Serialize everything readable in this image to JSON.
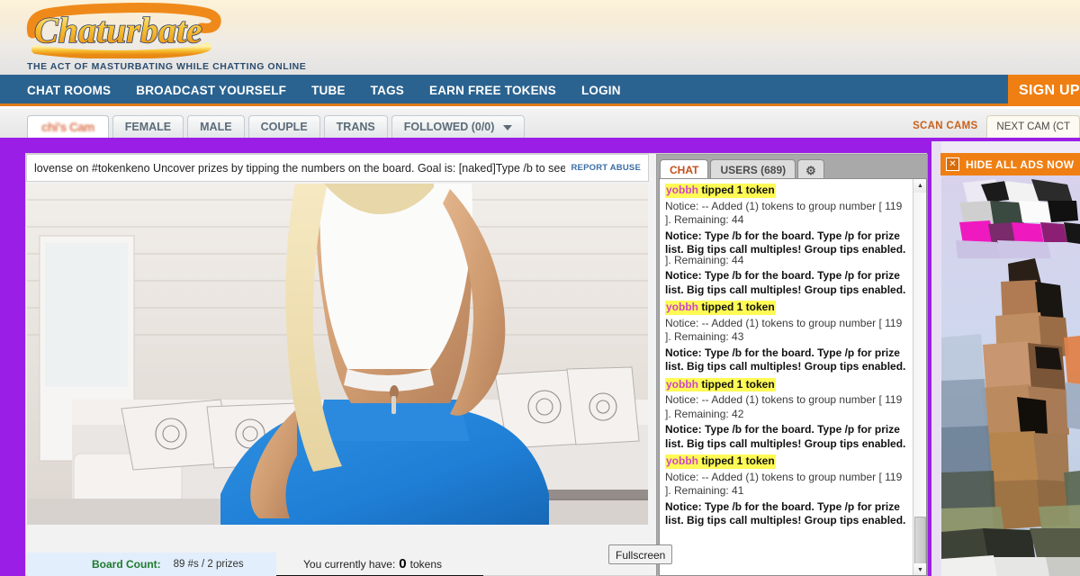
{
  "site": {
    "logo_text": "Chaturbate",
    "tagline": "THE ACT OF MASTURBATING WHILE CHATTING ONLINE"
  },
  "nav": {
    "items": [
      {
        "label": "CHAT ROOMS"
      },
      {
        "label": "BROADCAST YOURSELF"
      },
      {
        "label": "TUBE"
      },
      {
        "label": "TAGS"
      },
      {
        "label": "EARN FREE TOKENS"
      },
      {
        "label": "LOGIN"
      }
    ],
    "signup_label": "SIGN UP"
  },
  "subnav": {
    "tabs": [
      {
        "label": "chi's Cam",
        "active": true,
        "obscured": true
      },
      {
        "label": "FEMALE",
        "active": false
      },
      {
        "label": "MALE",
        "active": false
      },
      {
        "label": "COUPLE",
        "active": false
      },
      {
        "label": "TRANS",
        "active": false
      },
      {
        "label": "FOLLOWED (0/0)",
        "active": false,
        "caret": true
      }
    ],
    "scan_cams_label": "SCAN CAMS",
    "next_cam_label": "NEXT CAM (CT"
  },
  "player": {
    "topic": "lovense on #tokenkeno Uncover prizes by tipping the numbers on the board. Goal is: [naked]Type /b to see",
    "report_abuse_label": "REPORT ABUSE",
    "fullscreen_tooltip": "Fullscreen",
    "resize_handle_glyph": "◄►"
  },
  "info_strip": {
    "board_count_label": "Board Count:",
    "board_count_value": "89 #s / 2 prizes",
    "tokens_prefix": "You currently have:",
    "tokens_value": "0",
    "tokens_suffix": "tokens"
  },
  "chat": {
    "tabs": [
      {
        "label": "CHAT",
        "active": true
      },
      {
        "label": "USERS (689)",
        "active": false
      }
    ],
    "settings_icon_glyph": "⚙",
    "scroll_up_glyph": "▲",
    "scroll_down_glyph": "▼",
    "messages": [
      {
        "kind": "tip",
        "user": "yobbh",
        "text": " tipped 1 token"
      },
      {
        "kind": "notice-plain",
        "text": "Notice: -- Added (1) tokens to group number [ 119 ]. Remaining: 44"
      },
      {
        "kind": "notice-bold",
        "text": "Notice: Type /b for the board. Type /p for prize list. Big tips call multiples! Group tips enabled.",
        "clipped": true
      },
      {
        "kind": "notice-plain",
        "text": "]. Remaining: 44",
        "overlap": true
      },
      {
        "kind": "notice-bold",
        "text": "Notice: Type /b for the board. Type /p for prize list. Big tips call multiples! Group tips enabled."
      },
      {
        "kind": "tip",
        "user": "yobbh",
        "text": " tipped 1 token"
      },
      {
        "kind": "notice-plain",
        "text": "Notice: -- Added (1) tokens to group number [ 119 ]. Remaining: 43"
      },
      {
        "kind": "notice-bold",
        "text": "Notice: Type /b for the board. Type /p for prize list. Big tips call multiples! Group tips enabled."
      },
      {
        "kind": "tip",
        "user": "yobbh",
        "text": " tipped 1 token"
      },
      {
        "kind": "notice-plain",
        "text": "Notice: -- Added (1) tokens to group number [ 119 ]. Remaining: 42"
      },
      {
        "kind": "notice-bold",
        "text": "Notice: Type /b for the board. Type /p for prize list. Big tips call multiples! Group tips enabled."
      },
      {
        "kind": "tip",
        "user": "yobbh",
        "text": " tipped 1 token"
      },
      {
        "kind": "notice-plain",
        "text": "Notice: -- Added (1) tokens to group number [ 119 ]. Remaining: 41"
      },
      {
        "kind": "notice-bold",
        "text": "Notice: Type /b for the board. Type /p for prize list. Big tips call multiples! Group tips enabled."
      }
    ]
  },
  "ads": {
    "hide_label": "HIDE ALL ADS NOW",
    "close_glyph": "✕"
  },
  "colors": {
    "nav_blue": "#2b6390",
    "accent_orange": "#ef7f12",
    "stage_purple": "#9b1ee6",
    "tip_highlight": "#fffa55",
    "username_pink": "#cf46c9",
    "board_green": "#1f7a2e",
    "link_blue": "#3a6ea5"
  }
}
